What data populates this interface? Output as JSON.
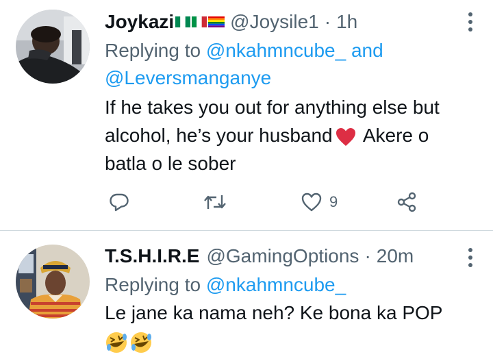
{
  "tweets": [
    {
      "name": "Joykazi",
      "handle": "@Joysile1",
      "separator": "·",
      "time": "1h",
      "replying_prefix": "Replying to ",
      "mention_1": "@nkahmncube_",
      "and_word": " and",
      "mention_2": "@Leversmanganye",
      "text_part1": "If he takes you out for anything else but alcohol, he’s your husband",
      "text_part2": " Akere o batla o le sober",
      "likes": "9",
      "icons": [
        "flag-nigeria",
        "flag-italy",
        "flag-rainbow",
        "red-heart",
        "reply-icon",
        "retweet-icon",
        "like-icon",
        "share-icon",
        "more-icon"
      ]
    },
    {
      "name": "T.S.H.I.R.E",
      "handle": "@GamingOptions",
      "separator": "·",
      "time": "20m",
      "replying_prefix": "Replying to ",
      "mention_1": "@nkahmncube_",
      "text": "Le jane ka nama neh? Ke bona ka POP",
      "icons": [
        "rolling-laughing-emoji",
        "rolling-laughing-emoji",
        "more-icon"
      ]
    }
  ],
  "colors": {
    "text": "#0f1419",
    "secondary": "#536471",
    "link": "#1d9bf0",
    "divider": "#cfd9de"
  }
}
